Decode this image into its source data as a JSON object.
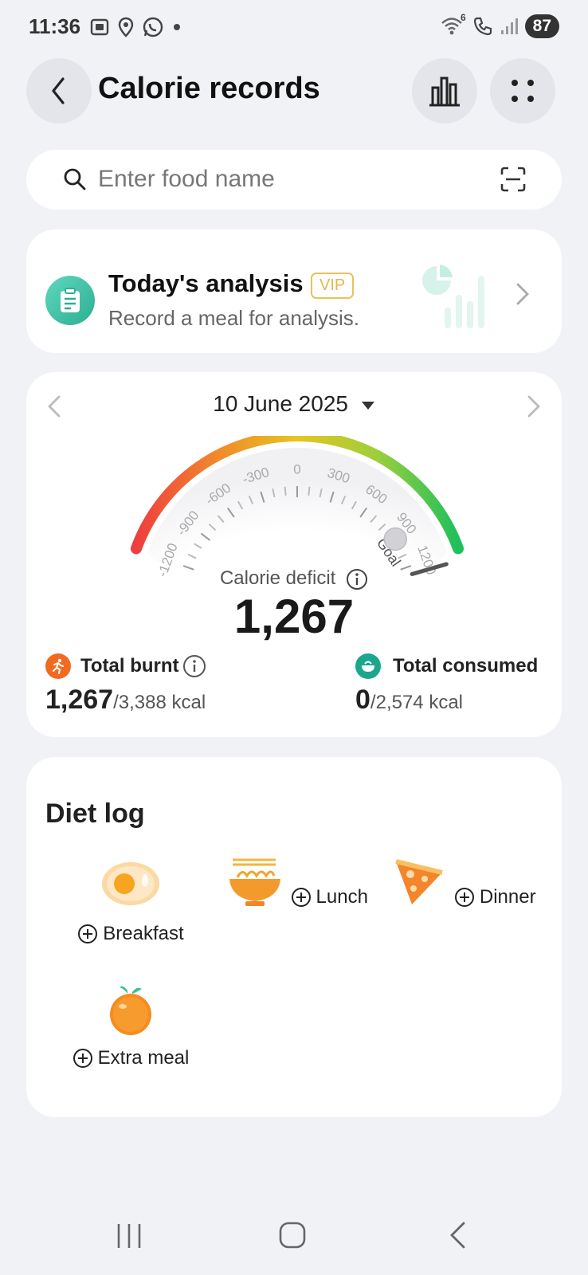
{
  "status": {
    "time": "11:36",
    "battery": "87",
    "icons_left": [
      "screenshot-icon",
      "location-icon",
      "whatsapp-icon",
      "dot-icon"
    ],
    "icons_right": [
      "wifi-icon",
      "call-icon",
      "signal-icon"
    ],
    "wifi_badge": "6"
  },
  "header": {
    "title": "Calorie records",
    "back_icon": "chevron-left-icon",
    "chart_icon": "bar-chart-icon",
    "more_icon": "grid-dots-icon"
  },
  "search": {
    "placeholder": "Enter food name",
    "icon": "search-icon",
    "scan_icon": "scan-icon"
  },
  "analysis": {
    "title": "Today's analysis",
    "badge": "VIP",
    "subtitle": "Record a meal for analysis.",
    "icon": "clipboard-icon",
    "accent": "#3fbfa3"
  },
  "calories": {
    "date": "10 June 2025",
    "gauge": {
      "ticks": [
        "-1200",
        "-900",
        "-600",
        "-300",
        "0",
        "300",
        "600",
        "900",
        "1200"
      ],
      "goal_label": "Goal",
      "min": -1200,
      "max": 1200,
      "value": 1267
    },
    "deficit_label": "Calorie deficit",
    "deficit_value": "1,267",
    "burnt": {
      "label": "Total burnt",
      "value": "1,267",
      "total": "/3,388 kcal",
      "color": "#f26a21"
    },
    "consumed": {
      "label": "Total consumed",
      "value": "0",
      "total": "/2,574 kcal",
      "color": "#1aa78c"
    }
  },
  "diet_log": {
    "title": "Diet log",
    "meals": [
      {
        "label": "Breakfast",
        "icon": "egg-icon"
      },
      {
        "label": "Lunch",
        "icon": "noodle-bowl-icon"
      },
      {
        "label": "Dinner",
        "icon": "pizza-icon"
      },
      {
        "label": "Extra meal",
        "icon": "orange-icon"
      }
    ]
  },
  "navbar": {
    "items": [
      "recents-icon",
      "home-icon",
      "back-icon"
    ]
  }
}
